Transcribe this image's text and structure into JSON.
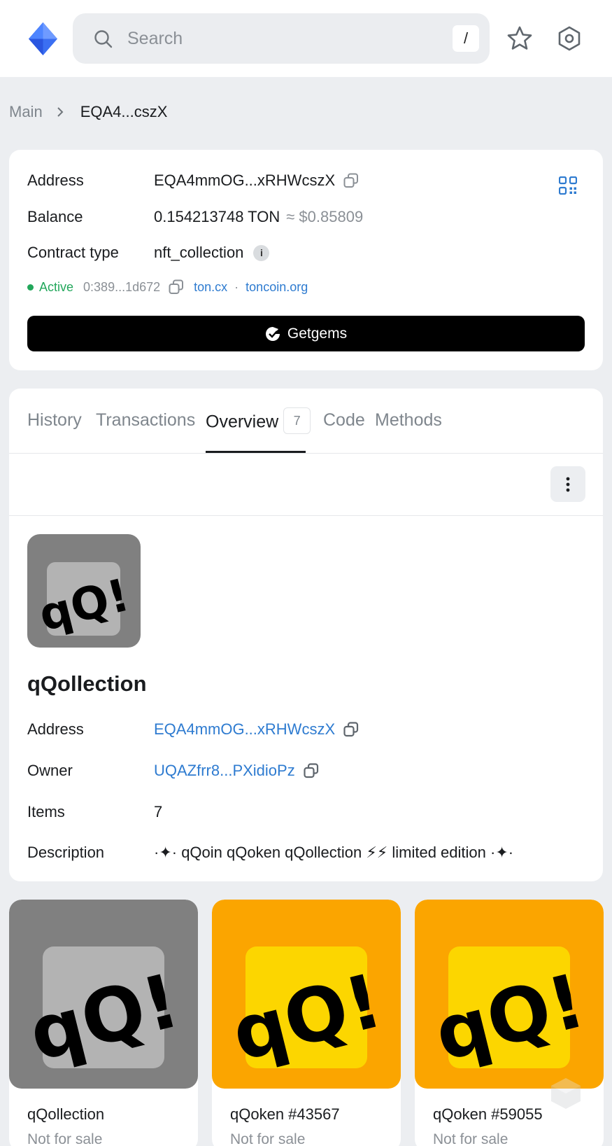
{
  "header": {
    "search_placeholder": "Search",
    "search_shortcut": "/",
    "icons": [
      "ton-logo-icon",
      "search-icon",
      "star-icon",
      "settings-icon"
    ]
  },
  "breadcrumb": {
    "root": "Main",
    "current": "EQA4...cszX"
  },
  "account": {
    "address_label": "Address",
    "address_value": "EQA4mmOG...xRHWcszX",
    "balance_label": "Balance",
    "balance_value": "0.154213748 TON",
    "balance_fiat": "≈ $0.85809",
    "contract_label": "Contract type",
    "contract_value": "nft_collection",
    "info_badge": "i",
    "status": "Active",
    "hash": "0:389...1d672",
    "explorer_1": "ton.cx",
    "explorer_sep": "·",
    "explorer_2": "toncoin.org",
    "getgems_button": "Getgems"
  },
  "tabs": [
    {
      "label": "History"
    },
    {
      "label": "Transactions"
    },
    {
      "label": "Overview",
      "count": "7",
      "active": true
    },
    {
      "label": "Code"
    },
    {
      "label": "Methods"
    }
  ],
  "collection": {
    "name": "qQollection",
    "address_label": "Address",
    "address_value": "EQA4mmOG...xRHWcszX",
    "owner_label": "Owner",
    "owner_value": "UQAZfrr8...PXidioPz",
    "items_label": "Items",
    "items_value": "7",
    "description_label": "Description",
    "description_value": "·✦· qQoin qQoken qQollection ⚡⚡ limited edition ·✦·"
  },
  "nfts": [
    {
      "title": "qQollection",
      "status": "Not for sale",
      "bg": "#808080",
      "inner": "#b3b3b3"
    },
    {
      "title": "qQoken #43567",
      "status": "Not for sale",
      "bg": "#fba500",
      "inner": "#fcd600"
    },
    {
      "title": "qQoken #59055",
      "status": "Not for sale",
      "bg": "#fba500",
      "inner": "#fcd600"
    }
  ],
  "colors": {
    "accent": "#2e7bd0",
    "active": "#22a75b",
    "text": "#1a1c1f",
    "muted": "#8b9096"
  }
}
